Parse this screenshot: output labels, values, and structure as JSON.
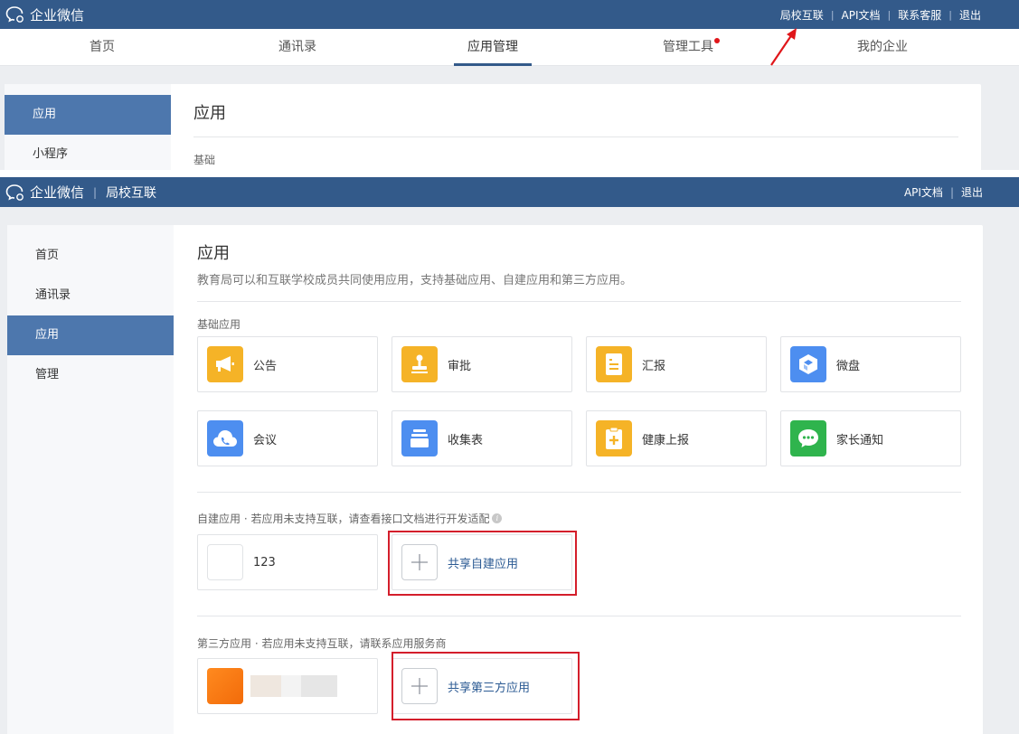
{
  "top": {
    "brand": "企业微信",
    "links": [
      "局校互联",
      "API文档",
      "联系客服",
      "退出"
    ],
    "nav": [
      "首页",
      "通讯录",
      "应用管理",
      "管理工具",
      "我的企业"
    ],
    "nav_active": "应用管理",
    "sidebar": [
      "应用",
      "小程序"
    ],
    "page_title": "应用",
    "section": "基础"
  },
  "bottom": {
    "brand": "企业微信",
    "brand_sub": "局校互联",
    "links": [
      "API文档",
      "退出"
    ],
    "sidebar": [
      "首页",
      "通讯录",
      "应用",
      "管理"
    ],
    "sidebar_active": "应用",
    "page_title": "应用",
    "description": "教育局可以和互联学校成员共同使用应用，支持基础应用、自建应用和第三方应用。",
    "basic_label": "基础应用",
    "basic_apps": [
      {
        "name": "公告",
        "icon": "megaphone-icon",
        "color": "#f5b327"
      },
      {
        "name": "审批",
        "icon": "stamp-icon",
        "color": "#f5b327"
      },
      {
        "name": "汇报",
        "icon": "report-icon",
        "color": "#f5b327"
      },
      {
        "name": "微盘",
        "icon": "cube-drive-icon",
        "color": "#4d8ef0"
      },
      {
        "name": "会议",
        "icon": "cloud-phone-icon",
        "color": "#4d8ef0"
      },
      {
        "name": "收集表",
        "icon": "stack-icon",
        "color": "#4d8ef0"
      },
      {
        "name": "健康上报",
        "icon": "clipboard-plus-icon",
        "color": "#f5b327"
      },
      {
        "name": "家长通知",
        "icon": "chat-bubble-icon",
        "color": "#2fb44d"
      }
    ],
    "custom_label": "自建应用 · 若应用未支持互联，请查看接口文档进行开发适配",
    "custom_apps": [
      {
        "name": "123"
      }
    ],
    "share_custom": "共享自建应用",
    "third_label": "第三方应用 · 若应用未支持互联，请联系应用服务商",
    "share_third": "共享第三方应用"
  },
  "colors": {
    "header": "#335a8a",
    "sidebar_active": "#4d77ad",
    "highlight_box": "#d41e2b",
    "arrow": "#e0161a"
  }
}
